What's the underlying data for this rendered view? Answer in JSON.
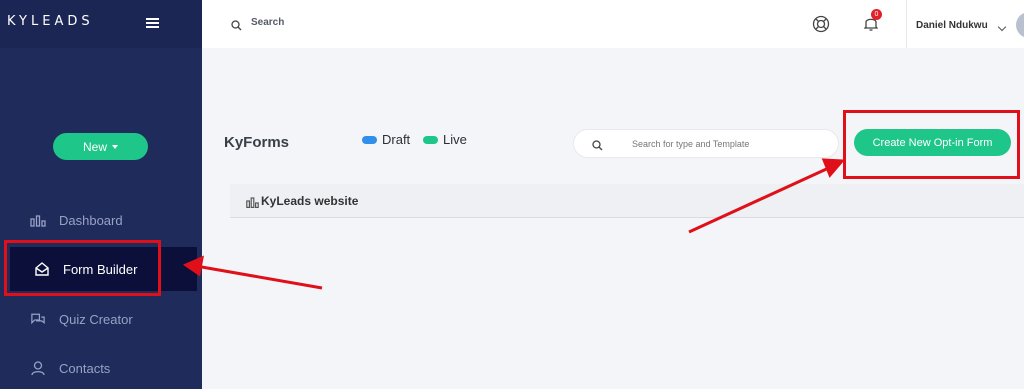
{
  "brand": "KYLEADS",
  "sidebar": {
    "new_label": "New",
    "items": [
      {
        "label": "Dashboard"
      },
      {
        "label": "Form Builder"
      },
      {
        "label": "Quiz Creator"
      },
      {
        "label": "Contacts"
      }
    ]
  },
  "topbar": {
    "search_label": "Search",
    "notification_count": "0",
    "user_name": "Daniel Ndukwu"
  },
  "main": {
    "title": "KyForms",
    "legend": [
      {
        "label": "Draft",
        "color": "#2f8fea"
      },
      {
        "label": "Live",
        "color": "#1fc68a"
      }
    ],
    "search_placeholder": "Search for type and Template",
    "create_button": "Create New Opt-in Form",
    "site_name": "KyLeads website"
  },
  "colors": {
    "accent": "#1fc68a",
    "sidebar": "#1f2b5b",
    "annotation": "#e0101a"
  }
}
